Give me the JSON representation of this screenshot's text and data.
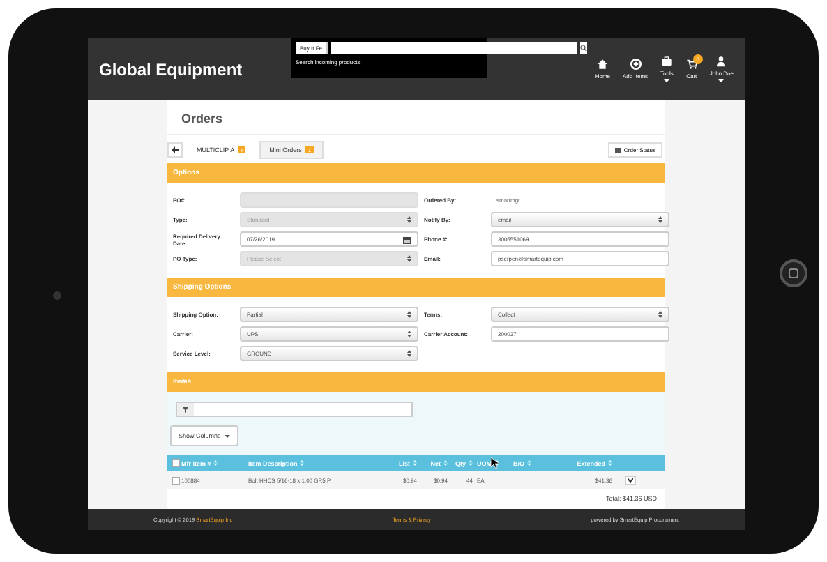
{
  "header": {
    "logo": "Global Equipment",
    "search": {
      "scope": "Buy It Fe",
      "hint": "Search incoming products"
    },
    "nav": [
      {
        "label": "Home",
        "caret": false
      },
      {
        "label": "Add Items",
        "caret": false
      },
      {
        "label": "Tools",
        "caret": true
      },
      {
        "label": "Cart",
        "badge": "0",
        "caret": false
      },
      {
        "label": "John Doe",
        "caret": true
      }
    ]
  },
  "page_title": "Orders",
  "tabs": [
    {
      "label": "MULTICLIP A",
      "badge": "x",
      "selected": true
    },
    {
      "label": "Mini Orders",
      "badge": "1",
      "selected": false
    }
  ],
  "order_status_button": "Order Status",
  "sections": [
    {
      "title": "Options",
      "rows": [
        [
          {
            "label": "PO#:",
            "kind": "input",
            "disabled": true
          },
          {
            "label": "Ordered By:",
            "kind": "text",
            "value": "smartmgr"
          }
        ],
        [
          {
            "label": "Type:",
            "kind": "select",
            "value": "Standard",
            "disabled": true
          },
          {
            "label": "Notify By:",
            "kind": "select",
            "value": "email",
            "disabled": false
          }
        ],
        [
          {
            "label": "Required Delivery Date:",
            "kind": "date",
            "value": "07/26/2019",
            "disabled": false
          },
          {
            "label": "Phone #:",
            "kind": "input",
            "value": "3005551069",
            "disabled": false
          }
        ],
        [
          {
            "label": "PO Type:",
            "kind": "select",
            "value": "Please Select",
            "disabled": true
          },
          {
            "label": "Email:",
            "kind": "input",
            "value": "pserpen@smartequip.com",
            "disabled": false
          }
        ]
      ]
    },
    {
      "title": "Shipping Options",
      "rows": [
        [
          {
            "label": "Shipping Option:",
            "kind": "select",
            "value": "Partial",
            "disabled": false
          },
          {
            "label": "Terms:",
            "kind": "select",
            "value": "Collect",
            "disabled": false
          }
        ],
        [
          {
            "label": "Carrier:",
            "kind": "select",
            "value": "UPS",
            "disabled": false
          },
          {
            "label": "Carrier Account:",
            "kind": "input",
            "value": "200037",
            "disabled": false
          }
        ],
        [
          {
            "label": "Service Level:",
            "kind": "select",
            "value": "GROUND",
            "disabled": false
          }
        ]
      ]
    }
  ],
  "items": {
    "title": "Items",
    "show_columns": "Show Columns",
    "select_all_checked": false,
    "columns": [
      "Mfr Item #",
      "Item Description",
      "List",
      "Net",
      "Qty",
      "UOM",
      "B/O",
      "Extended"
    ],
    "rows": [
      {
        "checked": false,
        "cells": [
          "100884",
          "Bolt HHCS 5/16-18 x 1.00 GR5 P",
          "$0.94",
          "$0.94",
          "44",
          "EA",
          null,
          "$41.36"
        ]
      }
    ],
    "total": "Total: $41.36 USD"
  },
  "footer": {
    "copyright": "Copyright © 2019",
    "company": "SmartEquip Inc",
    "terms": "Terms & Privacy",
    "powered": "powered by SmartEquip Procurement"
  }
}
